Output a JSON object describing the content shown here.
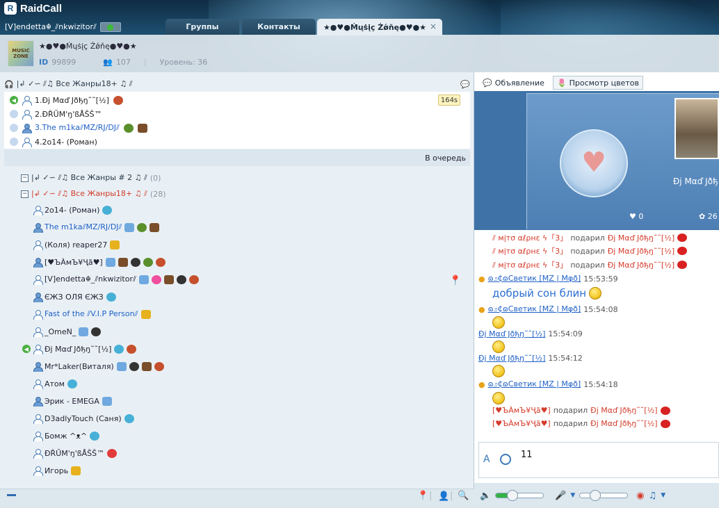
{
  "app": {
    "name": "RaidCall"
  },
  "user": {
    "name": "[V]endetta☬_⫽nkwizitor⫽"
  },
  "tabs": [
    {
      "label": "Группы"
    },
    {
      "label": "Контакты"
    },
    {
      "label": "★●♥●Ṁųṡįç Żǿňę●♥●★",
      "close": "×"
    }
  ],
  "channel": {
    "name": "★●♥●Ṁųṡįç Żǿňę●♥●★",
    "id_label": "ID",
    "id": "99899",
    "members": "107",
    "level": "Уровень: 36",
    "logo_text": "MUSIC ZONE"
  },
  "queue": {
    "title": "|↲ ✓∽ ⫽♫ Все Жанры18+ ♫ ⫽",
    "timer": "164s",
    "items": [
      {
        "name": "1.Ðj Mαď Jðђŋ˜˜[½]"
      },
      {
        "name": "2.ĐŘŰМ'ŋ'ßÅŠŠ™"
      },
      {
        "name": "3.The m1ka⫽MZ/RJ/DJ⫽"
      },
      {
        "name": "4.2o14- (Роман)"
      }
    ],
    "enqueue": "В очередь"
  },
  "tree": {
    "groups": [
      {
        "name": "|↲ ✓∽ ⫽♫ Все Жанры # 2 ♫ ⫽",
        "count": "(0)",
        "color": "#2b3b4a"
      },
      {
        "name": "|↲ ✓∽ ⫽♫ Все Жанры18+ ♫ ⫽",
        "count": "(28)",
        "color": "#d13b2b"
      }
    ],
    "members": [
      {
        "name": "2o14- (Роман)"
      },
      {
        "name": "The m1ka⫽MZ/RJ/DJ⫽"
      },
      {
        "name": "(Коля) reaper27"
      },
      {
        "name": "[♥ЪÀмЪ¥Ҷã♥]"
      },
      {
        "name": "[V]endetta☬_⫽nkwizitor⫽"
      },
      {
        "name": "ЄЖЗ ОЛЯ ЄЖЗ"
      },
      {
        "name": "Fast of the ⫽V.I.P Person⫽"
      },
      {
        "name": "_OmeN_"
      },
      {
        "name": "Ðj Mαď Jðђŋ˜˜[½]"
      },
      {
        "name": "Mr*Laker(Виталя)"
      },
      {
        "name": "Атом"
      },
      {
        "name": "Эрик - EMEGA"
      },
      {
        "name": "D3adlyTouch (Саня)"
      },
      {
        "name": "Бомж ^ᴥ^"
      },
      {
        "name": "ĐŘŰМ'ŋ'ßÅŠŠ™"
      },
      {
        "name": "Игорь"
      }
    ]
  },
  "right": {
    "announce": "Объявление",
    "colors": "Просмотр цветов",
    "gift_name": "Ðj Mαď Jðђ",
    "likes": "0",
    "gifts_count": "26"
  },
  "chat": {
    "gift_lines": [
      {
        "from": "⫽ мįтσ αℓρнε ϟ「3」",
        "verb": "подарил",
        "to": "Ðj Mαď Jðђŋ˜˜[½]"
      },
      {
        "from": "⫽ мįтσ αℓρнε ϟ「3」",
        "verb": "подарил",
        "to": "Ðj Mαď Jðђŋ˜˜[½]"
      },
      {
        "from": "⫽ мįтσ αℓρнε ϟ「3」",
        "verb": "подарил",
        "to": "Ðj Mαď Jðђŋ˜˜[½]"
      }
    ],
    "messages": [
      {
        "user": "ɷ೨₵ɷСветик [MZ | Mφð]",
        "time": "15:53:59",
        "text": "добрый сон блин"
      },
      {
        "user": "ɷ೨₵ɷСветик [MZ | Mφð]",
        "time": "15:54:08"
      },
      {
        "user": "Ðj Mαď Jðђŋ˜˜[½]",
        "time": "15:54:09"
      },
      {
        "user": "Ðj Mαď Jðђŋ˜˜[½]",
        "time": "15:54:12"
      },
      {
        "user": "ɷ೨₵ɷСветик [MZ | Mφð]",
        "time": "15:54:18"
      }
    ],
    "gift_lines2": [
      {
        "from": "[♥ЪÀмЪ¥Ҷã♥]",
        "verb": "подарил",
        "to": "Ðj Mαď Jðђŋ˜˜[½]"
      },
      {
        "from": "[♥ЪÀмЪ¥Ҷã♥]",
        "verb": "подарил",
        "to": "Ðj Mαď Jðђŋ˜˜[½]"
      }
    ],
    "input_value": "11"
  }
}
